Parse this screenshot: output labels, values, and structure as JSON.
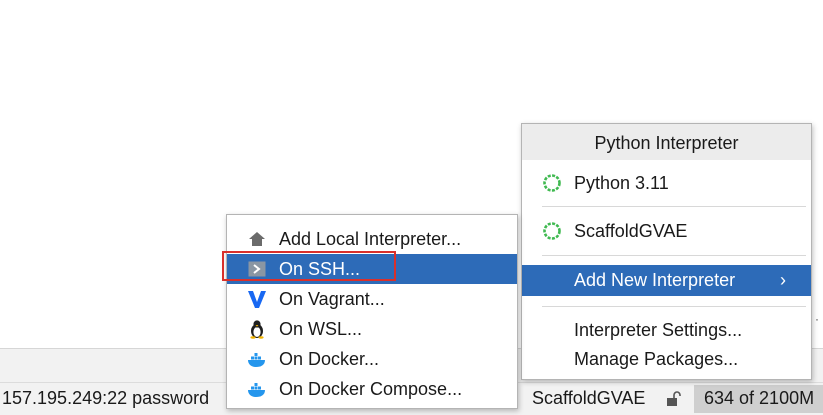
{
  "status_bar": {
    "connection": "157.195.249:22 password",
    "interpreter": "ScaffoldGVAE",
    "memory": "634 of 2100M"
  },
  "interpreter_popup": {
    "title": "Python Interpreter",
    "interpreters": [
      {
        "label": "Python 3.11",
        "icon": "python-ring-icon"
      },
      {
        "label": "ScaffoldGVAE",
        "icon": "python-ring-icon"
      }
    ],
    "add_new": {
      "label": "Add New Interpreter",
      "chevron": "›"
    },
    "settings": "Interpreter Settings...",
    "manage": "Manage Packages..."
  },
  "add_interpreter_submenu": {
    "items": [
      {
        "label": "Add Local Interpreter...",
        "icon": "home-icon"
      },
      {
        "label": "On SSH...",
        "icon": "ssh-terminal-icon",
        "selected": true
      },
      {
        "label": "On Vagrant...",
        "icon": "vagrant-icon"
      },
      {
        "label": "On WSL...",
        "icon": "linux-penguin-icon"
      },
      {
        "label": "On Docker...",
        "icon": "docker-icon"
      },
      {
        "label": "On Docker Compose...",
        "icon": "docker-compose-icon"
      }
    ]
  },
  "colors": {
    "selection": "#2d6bb8",
    "annotation_box": "#d9302b",
    "ring_green": "#3fb950"
  }
}
